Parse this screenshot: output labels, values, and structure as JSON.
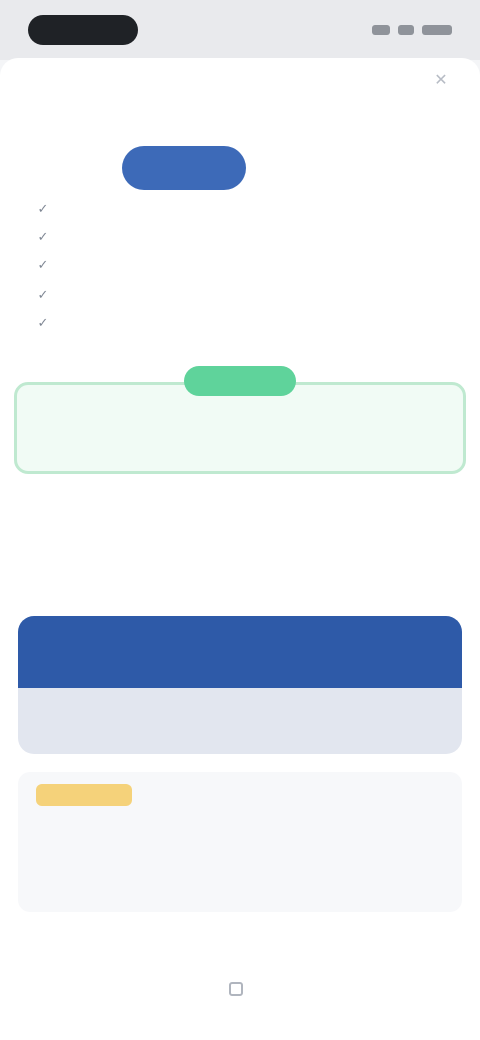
{
  "status_bar": {
    "time": ""
  },
  "plan": {
    "label": "",
    "sublabel": ""
  },
  "features": [
    {
      "text": ""
    },
    {
      "text": ""
    },
    {
      "text": ""
    },
    {
      "text": ""
    },
    {
      "text": ""
    }
  ],
  "trial": {
    "badge": "",
    "text": ""
  },
  "renewal": {
    "text": "",
    "subtext": ""
  },
  "divider": {
    "text": ""
  },
  "cta": {
    "label": "",
    "strip_text": ""
  },
  "promo": {
    "tag": "",
    "body": "",
    "foot": ""
  },
  "footer": {
    "link": ""
  },
  "colors": {
    "primary": "#2e5aa8",
    "pill": "#3d6ab8",
    "trial_badge": "#5fd39b",
    "trial_border": "#bfe9d0",
    "promo_tag": "#f5d27a"
  },
  "icons": [
    "close-icon",
    "check-icon",
    "lock-icon"
  ]
}
